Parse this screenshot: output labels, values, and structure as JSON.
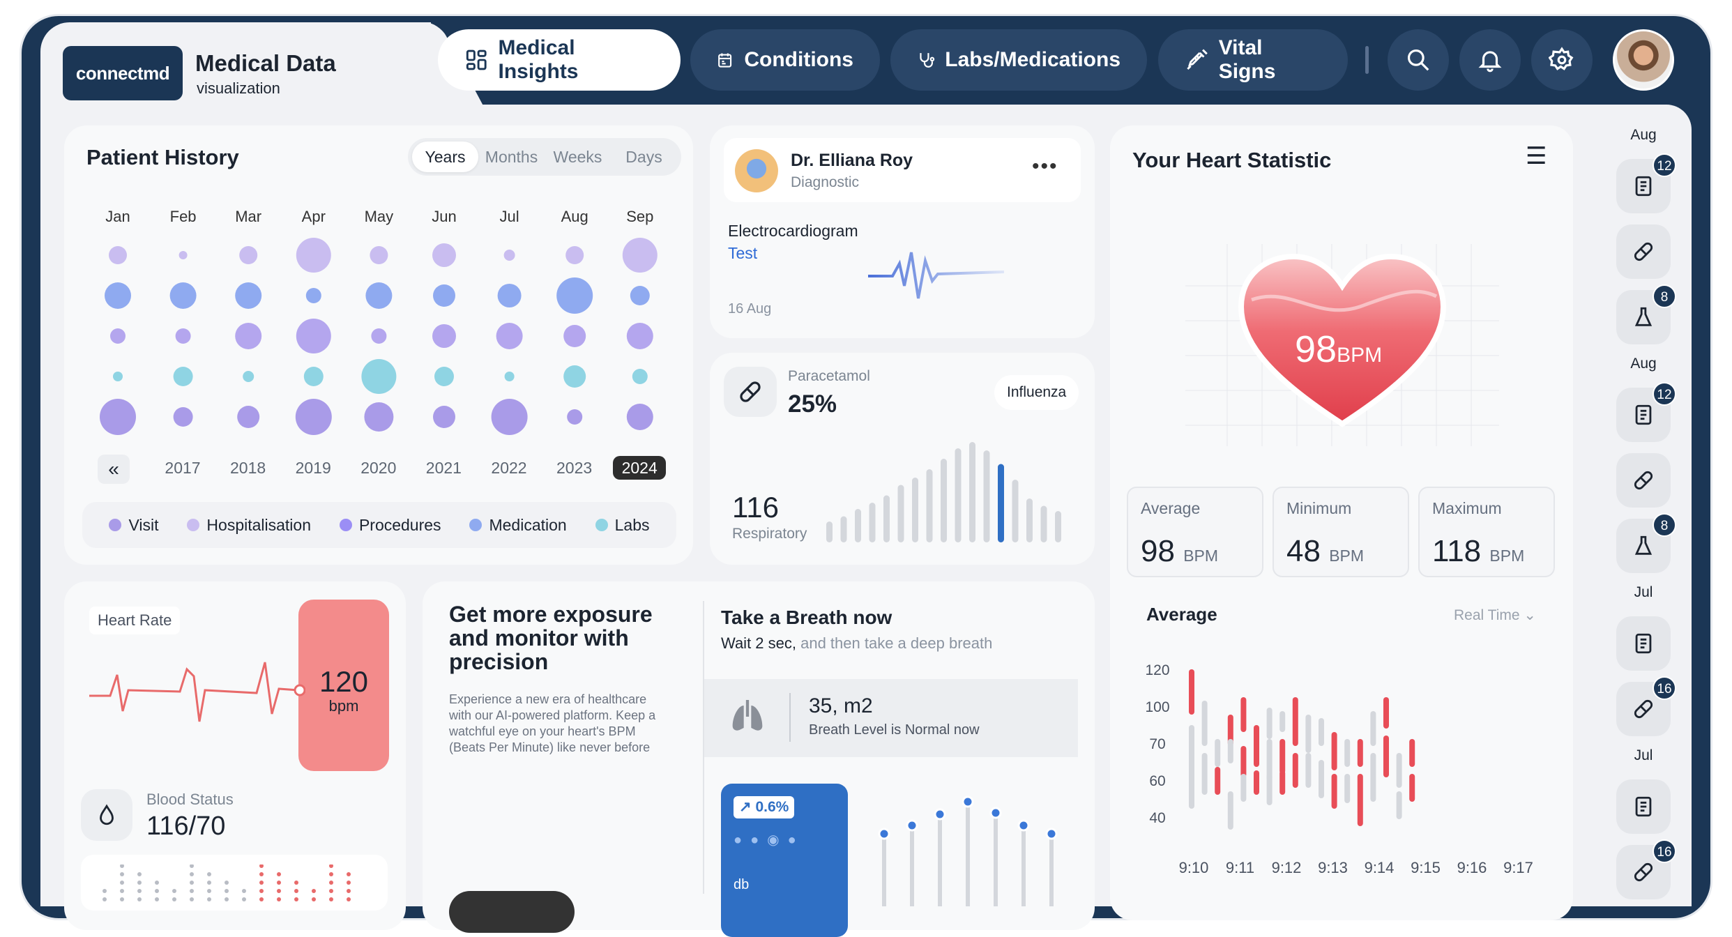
{
  "header": {
    "logo_text": "connectmd",
    "app_title": "Medical Data",
    "app_subtitle": "visualization",
    "tabs": [
      {
        "label": "Medical Insights",
        "icon": "dashboard-grid-icon",
        "active": true
      },
      {
        "label": "Conditions",
        "icon": "calendar-clipboard-icon",
        "active": false
      },
      {
        "label": "Labs/Medications",
        "icon": "stethoscope-icon",
        "active": false
      },
      {
        "label": "Vital Signs",
        "icon": "syringe-icon",
        "active": false
      }
    ],
    "actions": [
      "search-icon",
      "bell-icon",
      "gear-icon"
    ]
  },
  "patient_history": {
    "title": "Patient History",
    "ranges": [
      "Years",
      "Months",
      "Weeks",
      "Days"
    ],
    "selected_range": "Years",
    "months": [
      "Jan",
      "Feb",
      "Mar",
      "Apr",
      "May",
      "Jun",
      "Jul",
      "Aug",
      "Sep"
    ],
    "years": [
      "2017",
      "2018",
      "2019",
      "2020",
      "2021",
      "2022",
      "2023",
      "2024"
    ],
    "selected_year": "2024",
    "legend": [
      {
        "label": "Visit",
        "color": "#a99be8"
      },
      {
        "label": "Hospitalisation",
        "color": "#c9bdf0"
      },
      {
        "label": "Procedures",
        "color": "#9b8ef5"
      },
      {
        "label": "Medication",
        "color": "#8faaf0"
      },
      {
        "label": "Labs",
        "color": "#8fd4e3"
      }
    ]
  },
  "doctor_card": {
    "name": "Dr. Elliana Roy",
    "role": "Diagnostic",
    "test_name": "Electrocardiogram",
    "test_link": "Test",
    "date": "16 Aug"
  },
  "medication_card": {
    "drug": "Paracetamol",
    "percent": "25%",
    "tag": "Influenza",
    "value": "116",
    "label": "Respiratory"
  },
  "heart_statistic": {
    "title": "Your Heart Statistic",
    "bpm_value": "98",
    "bpm_unit": "BPM",
    "stats": [
      {
        "label": "Average",
        "value": "98",
        "unit": "BPM"
      },
      {
        "label": "Minimum",
        "value": "48",
        "unit": "BPM"
      },
      {
        "label": "Maximum",
        "value": "118",
        "unit": "BPM"
      }
    ],
    "chart_title": "Average",
    "chart_mode": "Real Time"
  },
  "heart_rate_card": {
    "label": "Heart Rate",
    "value": "120",
    "unit": "bpm",
    "blood_label": "Blood Status",
    "blood_value": "116/70"
  },
  "promo_card": {
    "title": "Get more exposure and monitor with precision",
    "body": "Experience a new era of healthcare with our AI-powered platform. Keep a watchful eye on your heart's BPM (Beats Per Minute) like never before"
  },
  "breath_card": {
    "title": "Take a Breath now",
    "subtitle_strong": "Wait 2 sec,",
    "subtitle_rest": " and then take a deep breath",
    "value": "35, m2",
    "status": "Breath Level is Normal now",
    "change": "0.6%",
    "unit_label": "db"
  },
  "right_rail": [
    {
      "label": "Aug",
      "items": [
        {
          "icon": "document-icon",
          "badge": "12"
        },
        {
          "icon": "pill-icon",
          "badge": ""
        },
        {
          "icon": "flask-icon",
          "badge": "8"
        }
      ]
    },
    {
      "label": "Aug",
      "items": [
        {
          "icon": "document-icon",
          "badge": "12"
        },
        {
          "icon": "pill-icon",
          "badge": ""
        },
        {
          "icon": "flask-icon",
          "badge": "8"
        }
      ]
    },
    {
      "label": "Jul",
      "items": [
        {
          "icon": "document-icon",
          "badge": ""
        },
        {
          "icon": "pill-icon",
          "badge": "16"
        }
      ]
    },
    {
      "label": "Jul",
      "items": [
        {
          "icon": "document-icon",
          "badge": ""
        },
        {
          "icon": "pill-icon",
          "badge": "16"
        }
      ]
    }
  ],
  "chart_data": [
    {
      "type": "bar",
      "title": "Average",
      "x": [
        "9:10",
        "9:11",
        "9:12",
        "9:13",
        "9:14",
        "9:15",
        "9:16",
        "9:17"
      ],
      "y_ticks": [
        "120",
        "100",
        "70",
        "60",
        "40"
      ],
      "ylim": [
        40,
        120
      ],
      "series": [
        {
          "values": [
            [
              100,
              120
            ],
            [
              68,
              100
            ],
            [
              40,
              105
            ],
            [
              52,
              108
            ],
            [
              80,
              98
            ],
            [
              50,
              110
            ],
            [
              60,
              104
            ],
            [
              45,
              95
            ]
          ]
        }
      ]
    },
    {
      "type": "bar",
      "title": "Respiratory",
      "values": [
        20,
        25,
        32,
        38,
        45,
        55,
        62,
        70,
        80,
        90,
        96,
        88,
        75,
        60,
        42,
        35,
        30
      ],
      "highlight_index": 12
    }
  ]
}
